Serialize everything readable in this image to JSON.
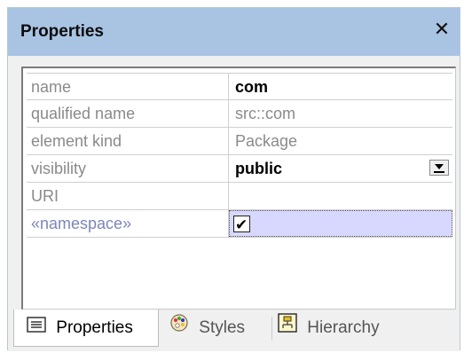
{
  "panel": {
    "title": "Properties",
    "close_glyph": "✕"
  },
  "properties": [
    {
      "name": "name",
      "value": "com",
      "editable": true
    },
    {
      "name": "qualified name",
      "value": "src::com",
      "editable": false
    },
    {
      "name": "element kind",
      "value": "Package",
      "editable": false
    },
    {
      "name": "visibility",
      "value": "public",
      "editable": true,
      "control": "dropdown"
    },
    {
      "name": "URI",
      "value": "",
      "editable": true
    },
    {
      "name": "«namespace»",
      "value": "",
      "editable": true,
      "control": "checkbox",
      "checked": true,
      "selected": true
    }
  ],
  "tabs": [
    {
      "label": "Properties",
      "icon": "properties-icon",
      "active": true
    },
    {
      "label": "Styles",
      "icon": "palette-icon",
      "active": false
    },
    {
      "label": "Hierarchy",
      "icon": "hierarchy-icon",
      "active": false
    }
  ],
  "colors": {
    "titlebar": "#a9c4e3",
    "selection": "#d8d8ff"
  }
}
